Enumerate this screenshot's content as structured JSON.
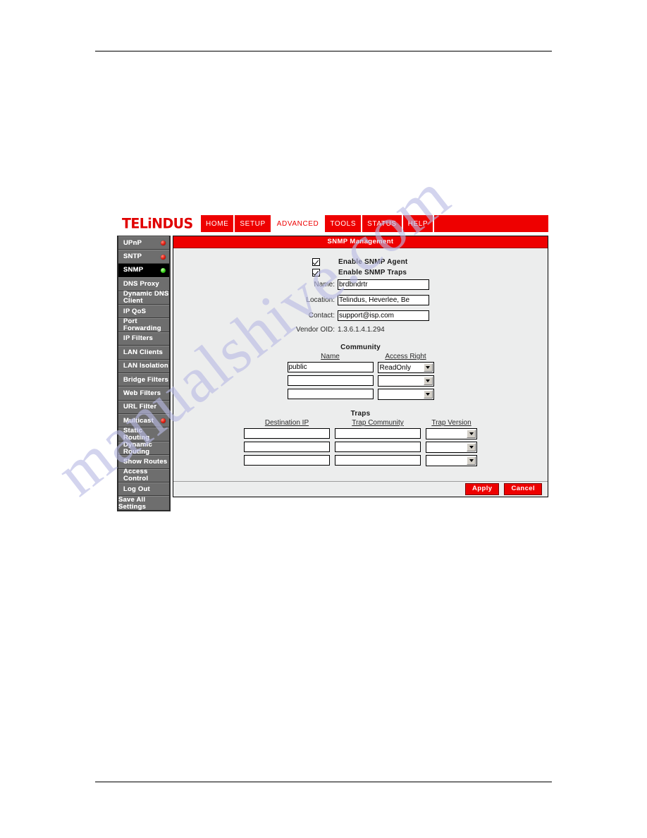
{
  "watermark": {
    "text": "manualshive.com"
  },
  "brand": {
    "logo_text": "TELiNDUS",
    "accent_color": "#ee0000"
  },
  "nav": {
    "items": [
      {
        "label": "HOME",
        "active": false
      },
      {
        "label": "SETUP",
        "active": false
      },
      {
        "label": "ADVANCED",
        "active": true
      },
      {
        "label": "TOOLS",
        "active": false
      },
      {
        "label": "STATUS",
        "active": false
      },
      {
        "label": "HELP",
        "active": false
      }
    ]
  },
  "sidebar": {
    "items": [
      {
        "label": "UPnP",
        "led": "red",
        "selected": false
      },
      {
        "label": "SNTP",
        "led": "red",
        "selected": false
      },
      {
        "label": "SNMP",
        "led": "green",
        "selected": true
      },
      {
        "label": "DNS Proxy",
        "led": "none",
        "selected": false
      },
      {
        "label": "Dynamic DNS Client",
        "led": "none",
        "selected": false
      },
      {
        "label": "IP QoS",
        "led": "none",
        "selected": false
      },
      {
        "label": "Port Forwarding",
        "led": "none",
        "selected": false
      },
      {
        "label": "IP Filters",
        "led": "none",
        "selected": false
      },
      {
        "label": "LAN Clients",
        "led": "none",
        "selected": false
      },
      {
        "label": "LAN Isolation",
        "led": "none",
        "selected": false
      },
      {
        "label": "Bridge Filters",
        "led": "none",
        "selected": false
      },
      {
        "label": "Web Filters",
        "led": "none",
        "selected": false
      },
      {
        "label": "URL Filter",
        "led": "none",
        "selected": false
      },
      {
        "label": "Multicast",
        "led": "red",
        "selected": false
      },
      {
        "label": "Static Routing",
        "led": "none",
        "selected": false
      },
      {
        "label": "Dynamic Routing",
        "led": "none",
        "selected": false
      },
      {
        "label": "Show Routes",
        "led": "none",
        "selected": false
      },
      {
        "label": "Access Control",
        "led": "none",
        "selected": false
      },
      {
        "label": "Log Out",
        "led": "none",
        "selected": false
      }
    ],
    "save_all": "Save All Settings"
  },
  "panel": {
    "title": "SNMP Management",
    "checkboxes": [
      {
        "label": "Enable SNMP Agent",
        "checked": true
      },
      {
        "label": "Enable SNMP Traps",
        "checked": true
      }
    ],
    "fields": [
      {
        "label": "Name:",
        "value": "brdbndrtr"
      },
      {
        "label": "Location:",
        "value": "Telindus, Heverlee, Be"
      },
      {
        "label": "Contact:",
        "value": "support@isp.com"
      }
    ],
    "vendor_oid": {
      "label": "Vendor OID:",
      "value": "1.3.6.1.4.1.294"
    },
    "community": {
      "title": "Community",
      "headers": [
        "Name",
        "Access Right"
      ],
      "rows": [
        {
          "name": "public",
          "access": "ReadOnly"
        },
        {
          "name": "",
          "access": ""
        },
        {
          "name": "",
          "access": ""
        }
      ]
    },
    "traps": {
      "title": "Traps",
      "headers": [
        "Destination IP",
        "Trap Community",
        "Trap Version"
      ],
      "rows": [
        {
          "dest": "",
          "community": "",
          "version": ""
        },
        {
          "dest": "",
          "community": "",
          "version": ""
        },
        {
          "dest": "",
          "community": "",
          "version": ""
        }
      ]
    },
    "buttons": {
      "apply": "Apply",
      "cancel": "Cancel"
    }
  }
}
